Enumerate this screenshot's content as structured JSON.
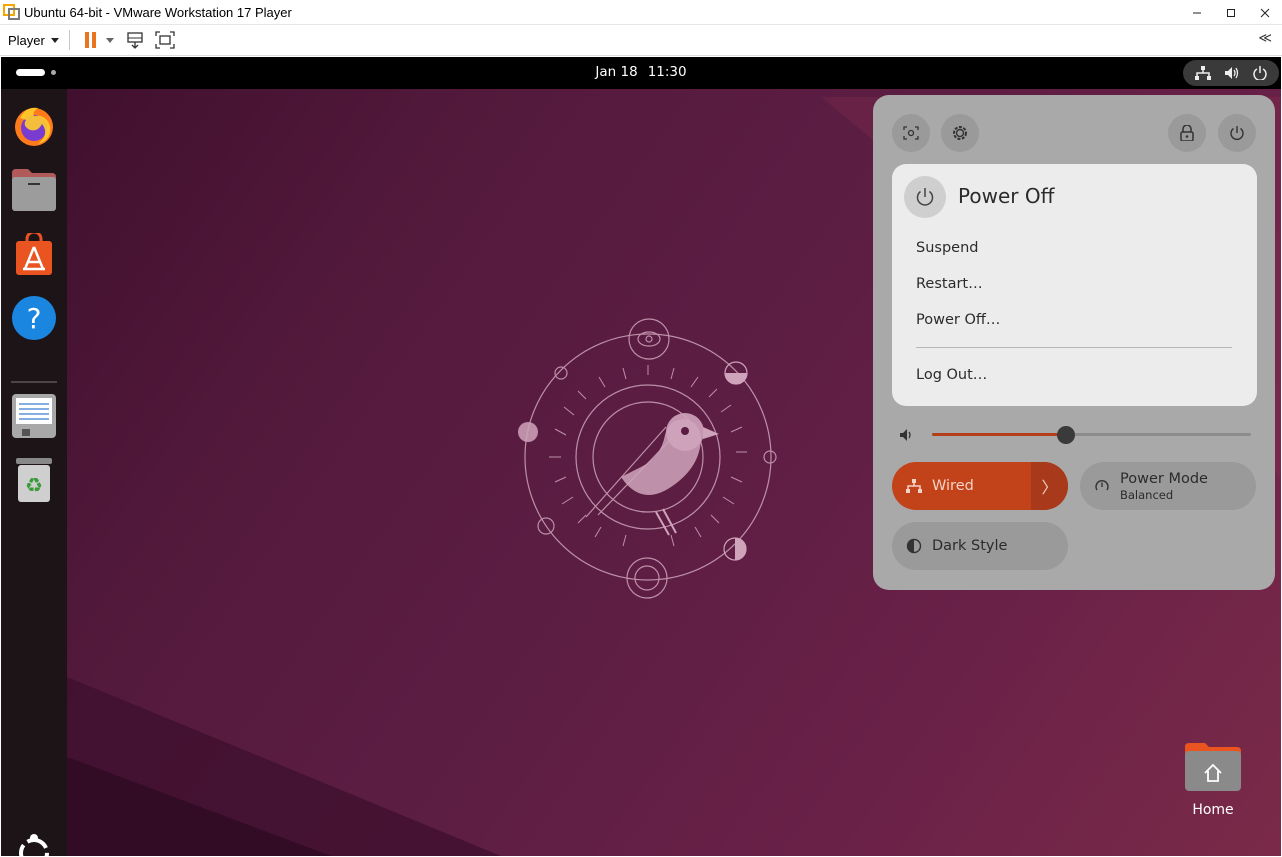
{
  "window": {
    "title": "Ubuntu 64-bit - VMware Workstation 17 Player",
    "controls": [
      "minimize-icon",
      "maximize-icon",
      "close-icon"
    ]
  },
  "toolbar": {
    "player_label": "Player",
    "icons": [
      "pause-icon",
      "dropdown-icon",
      "send-ctrl-alt-del-icon",
      "fullscreen-icon",
      "collapse-toolbar-icon"
    ],
    "collapse_glyph": "≪"
  },
  "topbar": {
    "date": "Jan 18",
    "time": "11:30",
    "tray_icons": [
      "network-wired-icon",
      "volume-icon",
      "power-icon"
    ]
  },
  "dock": {
    "items": [
      "firefox-icon",
      "files-icon",
      "app-center-icon",
      "help-icon",
      "text-editor-icon",
      "trash-icon",
      "show-apps-icon"
    ],
    "help_glyph": "?",
    "trash_glyph": "♻"
  },
  "quick_settings": {
    "top_buttons": [
      "screenshot-icon",
      "settings-icon",
      "lock-icon",
      "power-icon"
    ],
    "power_menu": {
      "title": "Power Off",
      "items": [
        "Suspend",
        "Restart…",
        "Power Off…"
      ],
      "logout": "Log Out…"
    },
    "volume": {
      "level": 0.42
    },
    "tiles": {
      "wired": {
        "label": "Wired",
        "active": true,
        "arrow": "〉"
      },
      "power_mode": {
        "label": "Power Mode",
        "sublabel": "Balanced"
      },
      "dark_style": {
        "label": "Dark Style"
      }
    }
  },
  "desktop": {
    "home_label": "Home"
  },
  "colors": {
    "accent": "#c2421a",
    "panel_bg": "#a9a9a9",
    "submenu_bg": "#ececec",
    "topbar_bg": "#000000",
    "dock_bg": "#1d1418"
  }
}
